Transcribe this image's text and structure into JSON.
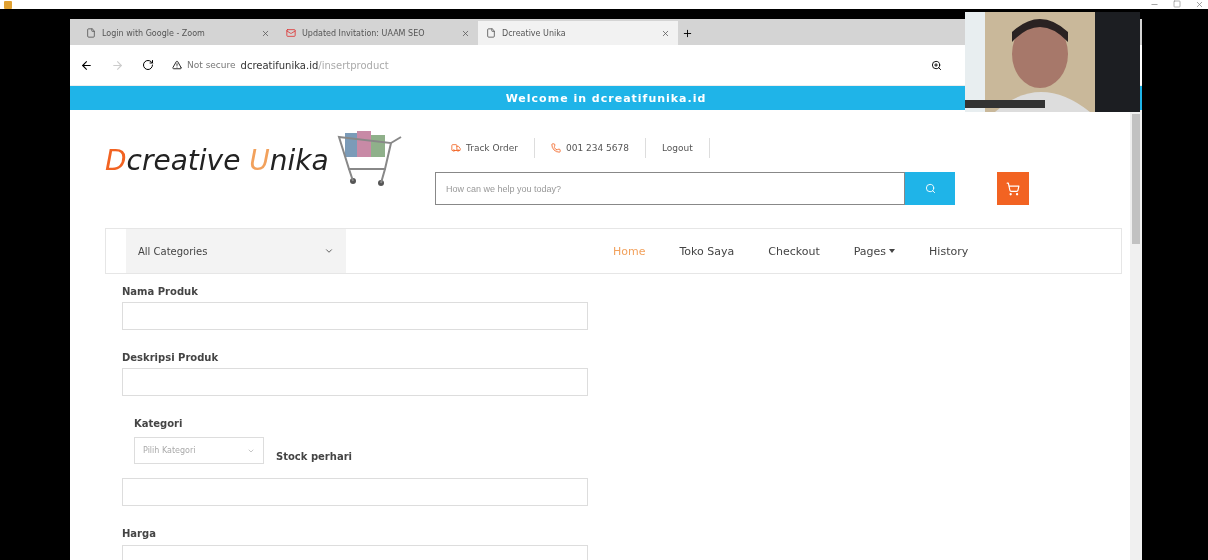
{
  "browser": {
    "tabs": [
      {
        "title": "Login with Google - Zoom",
        "kind": "page",
        "selected": false
      },
      {
        "title": "Updated Invitation: UAAM SEO",
        "kind": "mail",
        "selected": false
      },
      {
        "title": "Dcreative Unika",
        "kind": "page",
        "selected": true
      }
    ],
    "security": "Not secure",
    "url_host": "dcreatifunika.id",
    "url_path": "/insertproduct"
  },
  "banner": "Welcome in dcreatifunika.id",
  "logo": {
    "first_initial": "D",
    "first_rest": "creative",
    "second_initial": "U",
    "second_rest": "nika"
  },
  "top_links": [
    {
      "kind": "track",
      "label": "Track Order"
    },
    {
      "kind": "phone",
      "label": "001 234 5678"
    },
    {
      "kind": "plain",
      "label": "Logout"
    }
  ],
  "search": {
    "placeholder": "How can we help you today?"
  },
  "category_select": "All Categories",
  "nav": [
    {
      "label": "Home",
      "selected": true,
      "dropdown": false
    },
    {
      "label": "Toko Saya",
      "selected": false,
      "dropdown": false
    },
    {
      "label": "Checkout",
      "selected": false,
      "dropdown": false
    },
    {
      "label": "Pages",
      "selected": false,
      "dropdown": true
    },
    {
      "label": "History",
      "selected": false,
      "dropdown": false
    }
  ],
  "form": {
    "nama": "Nama Produk",
    "deskripsi": "Deskripsi Produk",
    "kategori": "Kategori",
    "kategori_select": "Pilih Kategori",
    "stock": "Stock perhari",
    "harga": "Harga"
  }
}
